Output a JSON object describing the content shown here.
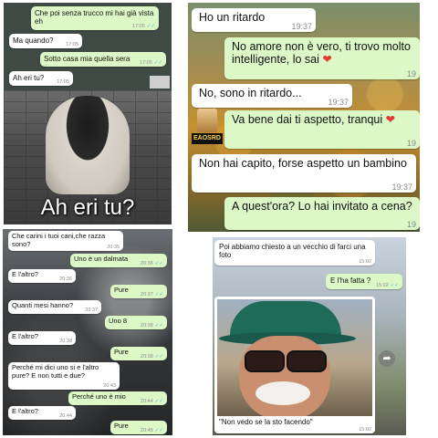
{
  "panel1": {
    "messages": [
      {
        "text": "Che poi senza trucco mi hai già vista eh",
        "time": "17:05",
        "tick": "✓✓"
      },
      {
        "text": "Ma quando?",
        "time": "17:05"
      },
      {
        "text": "Sotto casa mia quella sera",
        "time": "17:05",
        "tick": "✓✓"
      },
      {
        "text": "Ah eri tu?",
        "time": "17:05"
      }
    ],
    "caption": "Ah eri tu?"
  },
  "panel2": {
    "messages": [
      {
        "text": "Ho un ritardo",
        "time": "19:37"
      },
      {
        "text": "No amore non è vero, ti trovo molto intelligente, lo sai",
        "time": "19",
        "emoji": "❤"
      },
      {
        "text": "No, sono in ritardo...",
        "time": "19:37"
      },
      {
        "text": "Va bene dai ti aspetto, tranqui",
        "time": "19",
        "emoji": "❤"
      },
      {
        "text": "Non hai capito, forse aspetto un bambino",
        "time": "19:37"
      },
      {
        "text": "A quest'ora? Lo hai invitato a cena?",
        "time": "19"
      }
    ],
    "badge_text": "EAOSRD",
    "accent_heart": "#e53935"
  },
  "panel3": {
    "messages": [
      {
        "text": "Che carini i tuoi cani,che razza sono?",
        "time": "20:35"
      },
      {
        "text": "Uno è un dalmata",
        "time": "20:36",
        "tick": "✓✓"
      },
      {
        "text": "E l'altro?",
        "time": "20:36"
      },
      {
        "text": "Pure",
        "time": "20:37",
        "tick": "✓✓"
      },
      {
        "text": "Quanti mesi hanno?",
        "time": "20:37"
      },
      {
        "text": "Uno 8",
        "time": "20:38",
        "tick": "✓✓"
      },
      {
        "text": "E l'altro?",
        "time": "20:38"
      },
      {
        "text": "Pure",
        "time": "20:38",
        "tick": "✓✓"
      },
      {
        "text": "Perché mi dici uno si e l'altro pure? E non tutti e due?",
        "time": "20:43"
      },
      {
        "text": "Perché uno è mio",
        "time": "20:44",
        "tick": "✓✓"
      },
      {
        "text": "E l'altro?",
        "time": "20:44"
      },
      {
        "text": "Pure",
        "time": "20:45",
        "tick": "✓✓"
      }
    ]
  },
  "panel4": {
    "messages": [
      {
        "text": "Poi abbiamo chiesto a un vecchio di farci una foto",
        "time": "15:02"
      },
      {
        "text": "E l'ha fatta ?",
        "time": "15:02",
        "tick": "✓✓"
      }
    ],
    "photo_caption": "\"Non vedo se la sto facendo\"",
    "photo_time": "15:02",
    "share_icon": "share-icon"
  },
  "colors": {
    "outgoing_bubble": "#dcf8c6",
    "incoming_bubble": "#ffffff",
    "read_tick": "#4fb6ec"
  }
}
